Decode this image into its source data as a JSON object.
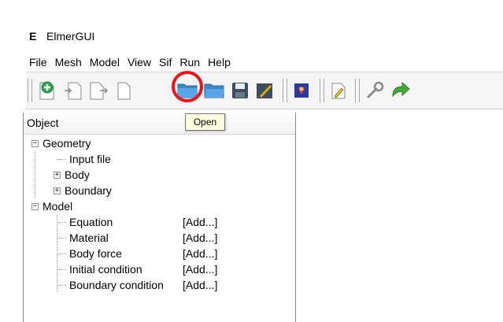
{
  "window": {
    "app_icon_letter": "E",
    "title": "ElmerGUI"
  },
  "menu": [
    "File",
    "Mesh",
    "Model",
    "View",
    "Sif",
    "Run",
    "Help"
  ],
  "toolbar": {
    "icons": [
      "new-project-icon",
      "open-project-icon",
      "save-project-icon",
      "new-document-icon",
      "open-icon",
      "open-folder-icon",
      "save-icon",
      "edit-icon",
      "model-icon",
      "edit-sif-icon",
      "settings-icon",
      "refresh-icon"
    ],
    "tooltip": "Open",
    "highlight_color": "#e8151b"
  },
  "tree": {
    "headers": [
      "Object",
      ""
    ],
    "geometry": {
      "label": "Geometry",
      "expander": "−"
    },
    "input_file": "Input file",
    "body": {
      "label": "Body",
      "expander": "+"
    },
    "boundary": {
      "label": "Boundary",
      "expander": "+"
    },
    "model": {
      "label": "Model",
      "expander": "−"
    },
    "model_items": [
      {
        "label": "Equation",
        "value": "[Add...]"
      },
      {
        "label": "Material",
        "value": "[Add...]"
      },
      {
        "label": "Body force",
        "value": "[Add...]"
      },
      {
        "label": "Initial condition",
        "value": "[Add...]"
      },
      {
        "label": "Boundary condition",
        "value": "[Add...]"
      }
    ]
  }
}
